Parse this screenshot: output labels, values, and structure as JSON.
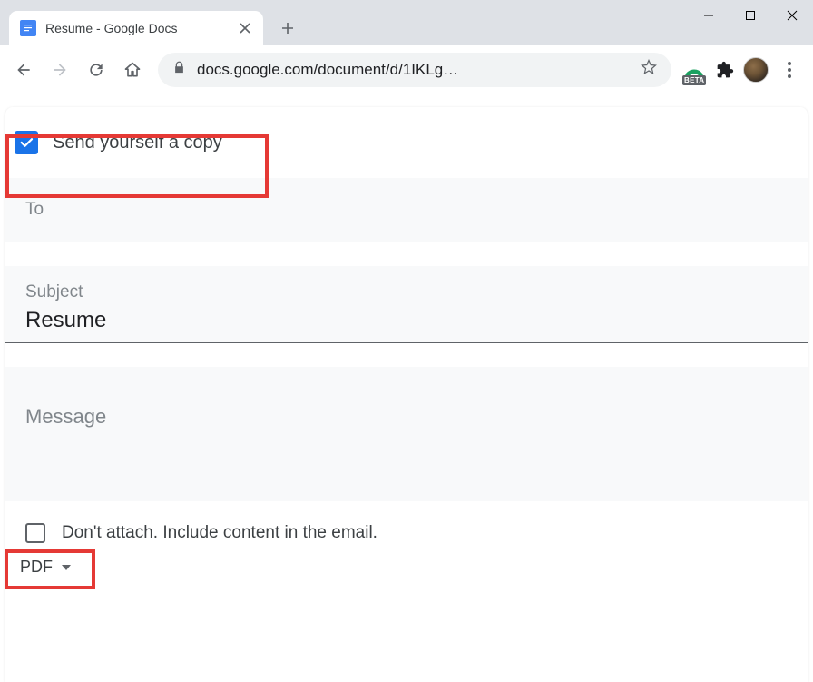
{
  "window": {
    "tab_title": "Resume - Google Docs",
    "url_display": "docs.google.com/document/d/1IKLg…"
  },
  "dialog": {
    "send_copy_label": "Send yourself a copy",
    "send_copy_checked": true,
    "to_label": "To",
    "to_value": "",
    "subject_label": "Subject",
    "subject_value": "Resume",
    "message_label": "Message",
    "message_value": "",
    "dont_attach_label": "Don't attach. Include content in the email.",
    "dont_attach_checked": false,
    "format_label": "PDF"
  },
  "icons": {
    "beta_text": "BETA"
  }
}
